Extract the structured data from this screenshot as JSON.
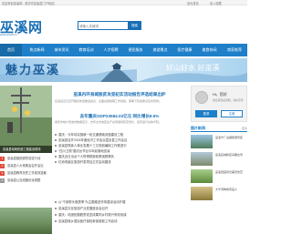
{
  "topbar": {
    "welcome": "欢迎来到巫溪网 - 重庆市巫溪县门户网站！",
    "links": [
      "设为首页",
      "加入收藏"
    ]
  },
  "header": {
    "logo_cn": "巫溪网",
    "logo_en": "www.wuxi0.cn",
    "search_placeholder": "请输入关键词",
    "search_button": "搜索"
  },
  "nav": {
    "items": [
      "首页",
      "热点新闻",
      "城市资讯",
      "教育培训",
      "人才招聘",
      "便民服务",
      "旅游景点",
      "医疗健康",
      "美食休闲",
      "商家推荐"
    ]
  },
  "banner": {
    "title": "魅力巫溪",
    "slogan": "好山好水 好巫溪"
  },
  "slider": {
    "caption": "巫溪县电网改造工程建设现场"
  },
  "headline": {
    "title": "巫溪内环县城脱贫攻坚纪实活动报告评选结果出炉",
    "desc": "巫溪县近日召开脱贫攻坚推进会议，全面总结前期工作经验，部署下阶段重点任务安排。",
    "sub": "去年重庆GDP23584.03亿元 同比增长8.5%",
    "desc2": "重庆市统计局发布数据显示，去年全市地区生产总值保持稳定增长，经济运行总体平稳。"
  },
  "news": [
    "重庆：今年将实施新一轮交通基础设施建设工程",
    "巫溪县召开2024年度经济工作会议暨全县工作会议",
    "巫溪县残疾人事业发展十三五规划编制工作推进中",
    "“四川卫视”重庆台节目今年起落地巫溪",
    "重庆近日出台个人所得税新政策减税降负",
    "红池坝景区旅游开发项目正式启动建设"
  ],
  "login": {
    "greeting": "Hi，您好",
    "sub": "欢迎来到巫溪网，请先登录",
    "login_button": "登录",
    "register_button": "注册"
  },
  "side": {
    "title": "图片新闻",
    "more": "更多",
    "items": [
      "巫溪宁厂古镇旅游景区",
      "巫溪县城新区鸟瞰全景",
      "巫溪田园风光美景欣赏",
      "大宁河畔春景宜人"
    ]
  },
  "bottom_left": {
    "rows": [
      "巫溪县推进脱贫攻坚行动",
      "巫溪县人大常委会召开会议",
      "巫溪县教育扶贫工作成效显著",
      "巫溪县公交线路优化调整"
    ]
  },
  "bottom_mid": {
    "rows": [
      "以“干部带头做表率”为主题推进作风建设活动开展",
      "巫溪县文化旅游产业发展座谈会召开",
      "重庆：巩固拓展脱贫攻坚成果同乡村振兴有效衔接",
      "巫溪县城乡居民医疗保险参保缴费工作启动"
    ],
    "title": "去年重庆GDP23584.03亿元 同比增长8.5%"
  },
  "colors": {
    "brand": "#1f7fc9",
    "logo": "#1a6fb5",
    "rank": "#e24b3d"
  }
}
